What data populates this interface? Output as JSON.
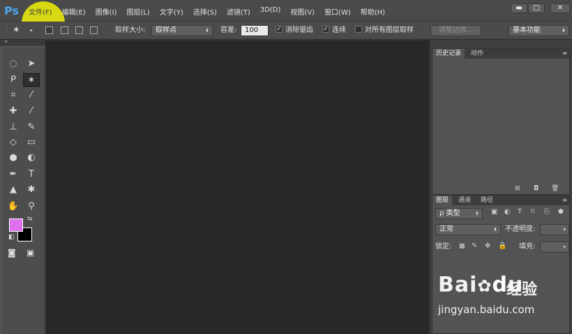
{
  "app": {
    "logo": "Ps"
  },
  "menu": [
    "文件(F)",
    "编辑(E)",
    "图像(I)",
    "图层(L)",
    "文字(Y)",
    "选择(S)",
    "滤镜(T)",
    "3D(D)",
    "视图(V)",
    "窗口(W)",
    "帮助(H)"
  ],
  "window_controls": [
    "▬",
    "□",
    "✕"
  ],
  "options": {
    "sample_size_label": "取样大小:",
    "sample_size_value": "取样点",
    "tolerance_label": "容差:",
    "tolerance_value": "100",
    "anti_alias_label": "消除锯齿",
    "anti_alias_checked": true,
    "contiguous_label": "连续",
    "contiguous_checked": true,
    "sample_all_layers_label": "对所有图层取样",
    "sample_all_layers_checked": false,
    "refine_edge_label": "调整边缘...",
    "workspace_value": "基本功能"
  },
  "toolbox": {
    "tools": [
      {
        "name": "marquee-tool",
        "glyph": "◌"
      },
      {
        "name": "move-tool",
        "glyph": "➤"
      },
      {
        "name": "lasso-tool",
        "glyph": "ᑭ"
      },
      {
        "name": "magic-wand-tool",
        "glyph": "✶",
        "active": true
      },
      {
        "name": "crop-tool",
        "glyph": "⌗"
      },
      {
        "name": "eyedropper-tool",
        "glyph": "⁄"
      },
      {
        "name": "healing-brush-tool",
        "glyph": "✚"
      },
      {
        "name": "brush-tool",
        "glyph": "⁄"
      },
      {
        "name": "clone-stamp-tool",
        "glyph": "⊥"
      },
      {
        "name": "history-brush-tool",
        "glyph": "✎"
      },
      {
        "name": "eraser-tool",
        "glyph": "◇"
      },
      {
        "name": "gradient-tool",
        "glyph": "▭"
      },
      {
        "name": "blur-tool",
        "glyph": "●"
      },
      {
        "name": "dodge-tool",
        "glyph": "◐"
      },
      {
        "name": "pen-tool",
        "glyph": "✒"
      },
      {
        "name": "type-tool",
        "glyph": "T"
      },
      {
        "name": "path-selection-tool",
        "glyph": "▲"
      },
      {
        "name": "shape-tool",
        "glyph": "✱"
      },
      {
        "name": "hand-tool",
        "glyph": "✋"
      },
      {
        "name": "zoom-tool",
        "glyph": "⚲"
      }
    ],
    "foreground_color": "#e070ee",
    "background_color": "#000000"
  },
  "panels": {
    "history_tab": "历史记录",
    "actions_tab": "动作",
    "layers_tab": "图层",
    "channels_tab": "通道",
    "paths_tab": "路径",
    "filter_kind": "ρ 类型",
    "blend_mode": "正常",
    "opacity_label": "不透明度:",
    "lock_label": "锁定:",
    "fill_label": "填充:"
  },
  "watermark": {
    "brand": "Bai",
    "brand_du": "du",
    "cn": "经验",
    "url": "jingyan.baidu.com"
  }
}
